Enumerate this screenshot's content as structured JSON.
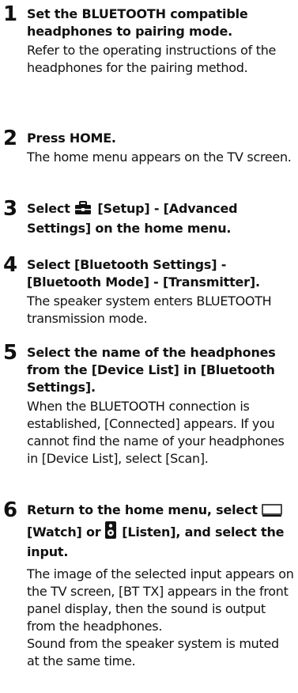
{
  "steps": [
    {
      "number": "1",
      "title": "Set the BLUETOOTH compatible headphones to pairing mode.",
      "description": "Refer to the operating instructions of the headphones for the pairing method."
    },
    {
      "number": "2",
      "title": "Press HOME.",
      "description": "The home menu appears on the TV screen."
    },
    {
      "number": "3",
      "title_prefix": "Select",
      "title_icon": "toolbox-icon",
      "title_suffix": "[Setup] - [Advanced Settings] on the home menu."
    },
    {
      "number": "4",
      "title": "Select [Bluetooth Settings] - [Bluetooth Mode] - [Transmitter].",
      "description": "The speaker system enters BLUETOOTH transmission mode."
    },
    {
      "number": "5",
      "title": "Select the name of the headphones from the [Device List] in [Bluetooth Settings].",
      "description": "When the BLUETOOTH connection is established, [Connected] appears. If you cannot find the name of your headphones in [Device List], select [Scan]."
    },
    {
      "number": "6",
      "title_part1": "Return to the home menu, select",
      "watch_icon": "tv-screen-icon",
      "title_part2": "[Watch] or",
      "listen_icon": "speaker-icon",
      "title_part3": "[Listen], and select the input.",
      "description": "The image of the selected input appears on the TV screen, [BT TX] appears in the front panel display, then the sound is output from the headphones.",
      "description2": "Sound from the speaker system is muted at the same time."
    }
  ]
}
